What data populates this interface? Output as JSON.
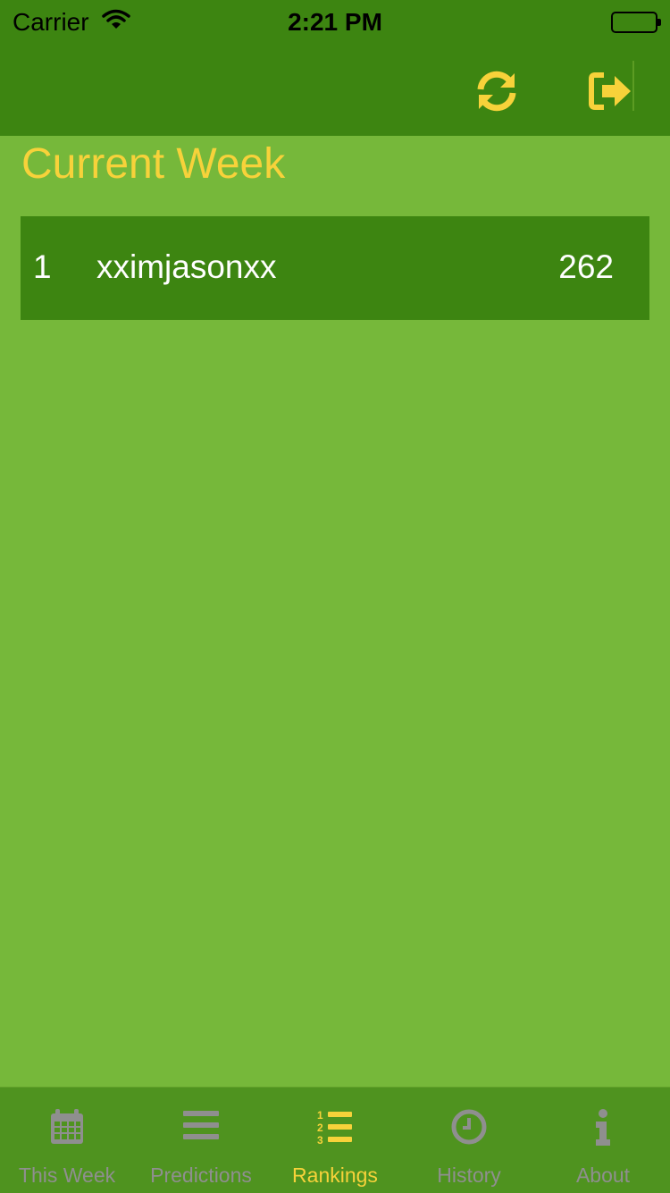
{
  "status_bar": {
    "carrier": "Carrier",
    "time": "2:21 PM"
  },
  "nav": {
    "refresh_icon": "refresh-icon",
    "logout_icon": "logout-icon"
  },
  "section": {
    "title": "Current Week"
  },
  "rankings": [
    {
      "rank": "1",
      "name": "xximjasonxx",
      "score": "262"
    }
  ],
  "tabs": [
    {
      "label": "This Week",
      "icon": "calendar-icon"
    },
    {
      "label": "Predictions",
      "icon": "list-icon"
    },
    {
      "label": "Rankings",
      "icon": "ranked-list-icon",
      "active": true
    },
    {
      "label": "History",
      "icon": "clock-icon"
    },
    {
      "label": "About",
      "icon": "info-icon"
    }
  ],
  "colors": {
    "bar_green": "#3d8511",
    "background_green": "#76b83a",
    "tab_bar_green": "#4f931f",
    "accent_yellow": "#f7d23a",
    "inactive_gray": "#8f8f8f"
  }
}
